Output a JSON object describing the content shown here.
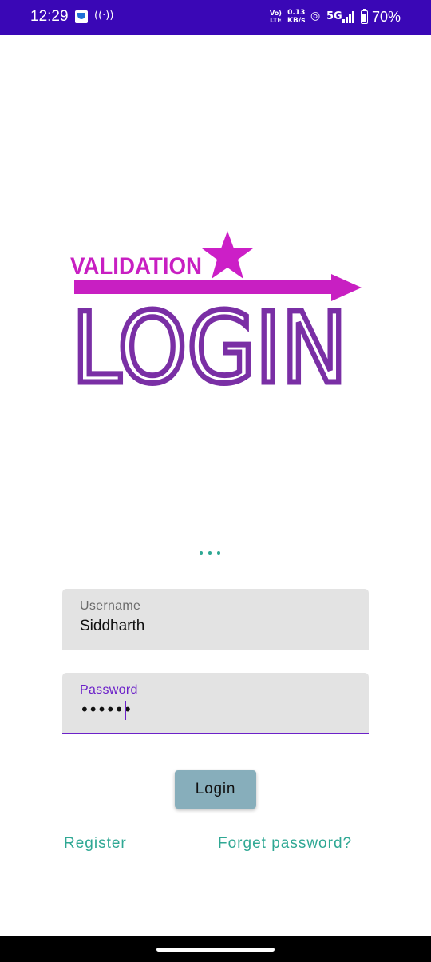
{
  "status_bar": {
    "time": "12:29",
    "volte_top": "Vo)",
    "volte_bottom": "LTE",
    "speed_value": "0.13",
    "speed_unit": "KB/s",
    "network": "5G",
    "battery": "70%",
    "background": "#3a07b6",
    "icons": [
      "app-notification-icon",
      "hotspot-icon",
      "wifi-calling-icon",
      "signal-icon",
      "battery-icon"
    ]
  },
  "logo": {
    "top_text": "VALIDATION",
    "main_text": "LOGIN",
    "top_color": "#c81fc2",
    "main_color": "#7a2fa5",
    "icons": [
      "star-icon",
      "arrow-icon"
    ]
  },
  "form": {
    "username": {
      "label": "Username",
      "value": "Siddharth"
    },
    "password": {
      "label": "Password",
      "value": "••••••"
    },
    "accent_color": "#6c21c9",
    "field_background": "#e3e3e3"
  },
  "actions": {
    "login_label": "Login",
    "register_label": "Register",
    "forget_label": "Forget password?",
    "button_color": "#87aebb",
    "link_color": "#2fa894"
  }
}
